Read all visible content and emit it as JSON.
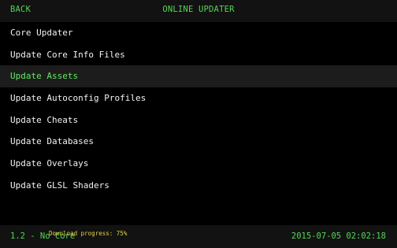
{
  "header": {
    "back_label": "BACK",
    "title": "ONLINE UPDATER"
  },
  "menu": {
    "items": [
      {
        "label": "Core Updater"
      },
      {
        "label": "Update Core Info Files"
      },
      {
        "label": "Update Assets"
      },
      {
        "label": "Update Autoconfig Profiles"
      },
      {
        "label": "Update Cheats"
      },
      {
        "label": "Update Databases"
      },
      {
        "label": "Update Overlays"
      },
      {
        "label": "Update GLSL Shaders"
      }
    ],
    "selected_index": 2
  },
  "footer": {
    "version_core": "1.2 - No Core",
    "datetime": "2015-07-05 02:02:18"
  },
  "notification": {
    "progress_text": "Download progress: 75%"
  },
  "colors": {
    "accent": "#52d652",
    "selected_text": "#62e862",
    "notification": "#e6d34a",
    "background": "#000000",
    "bar": "#121212"
  }
}
